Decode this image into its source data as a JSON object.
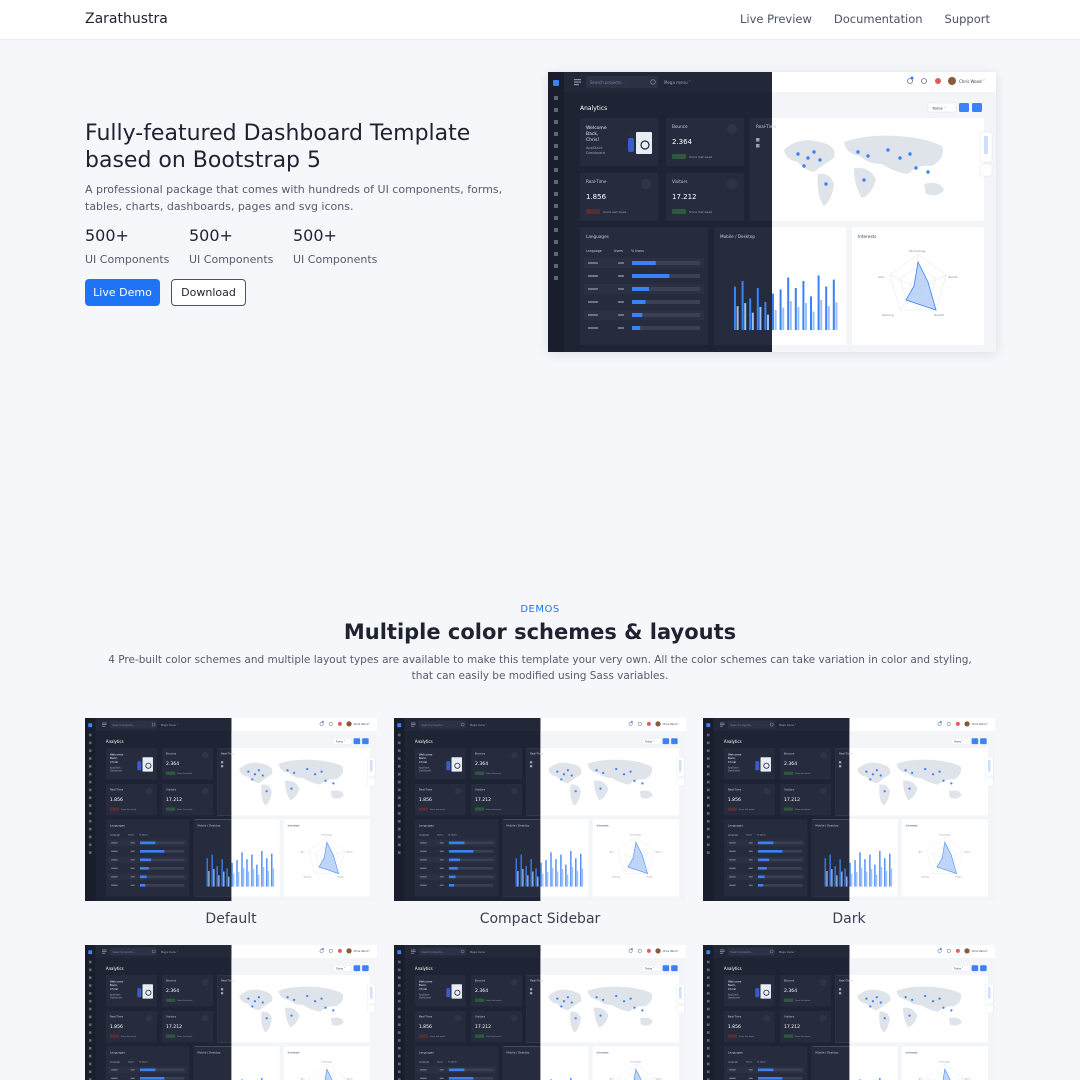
{
  "nav": {
    "brand": "Zarathustra",
    "links": [
      "Live Preview",
      "Documentation",
      "Support"
    ]
  },
  "hero": {
    "title": "Fully-featured Dashboard Template based on Bootstrap 5",
    "description": "A professional package that comes with hundreds of UI components, forms, tables, charts, dashboards, pages and svg icons.",
    "stats": [
      {
        "value": "500+",
        "label": "UI Components"
      },
      {
        "value": "500+",
        "label": "UI Components"
      },
      {
        "value": "500+",
        "label": "UI Components"
      }
    ],
    "primary_button": "Live Demo",
    "secondary_button": "Download"
  },
  "mockup": {
    "search_placeholder": "Search projects...",
    "mega_menu": "Mega menu",
    "user": "Chris Wood",
    "page_title": "Analytics",
    "today": "Today",
    "welcome": [
      "Welcome",
      "Back,",
      "Chris!"
    ],
    "welcome_sub": [
      "AppStack",
      "Dashboard"
    ],
    "cards": [
      {
        "title": "Bounce",
        "value": "2.364",
        "since": "Since last week"
      },
      {
        "title": "Real-Time",
        "value": "1.856",
        "since": "Since last week"
      },
      {
        "title": "Visitors",
        "value": "17.212",
        "since": "Since last week"
      }
    ],
    "realtime_title": "Real-Time",
    "languages_title": "Languages",
    "languages_headers": [
      "Language",
      "Users",
      "% Users"
    ],
    "mobile_desktop_title": "Mobile / Desktop",
    "interests_title": "Interests",
    "interests_labels": [
      "Technology",
      "Sports",
      "Health",
      "Gaming",
      "Arts"
    ],
    "builder_label": "Builder"
  },
  "demos": {
    "eyebrow": "DEMOS",
    "title": "Multiple color schemes & layouts",
    "description": "4 Pre-built color schemes and multiple layout types are available to make this template your very own. All the color schemes can take variation in color and styling, that can easily be modified using Sass variables.",
    "items": [
      "Default",
      "Compact Sidebar",
      "Dark"
    ]
  },
  "colors": {
    "accent": "#1e74f5",
    "dark_panel": "#1f2434",
    "page_bg": "#f5f7fb"
  }
}
